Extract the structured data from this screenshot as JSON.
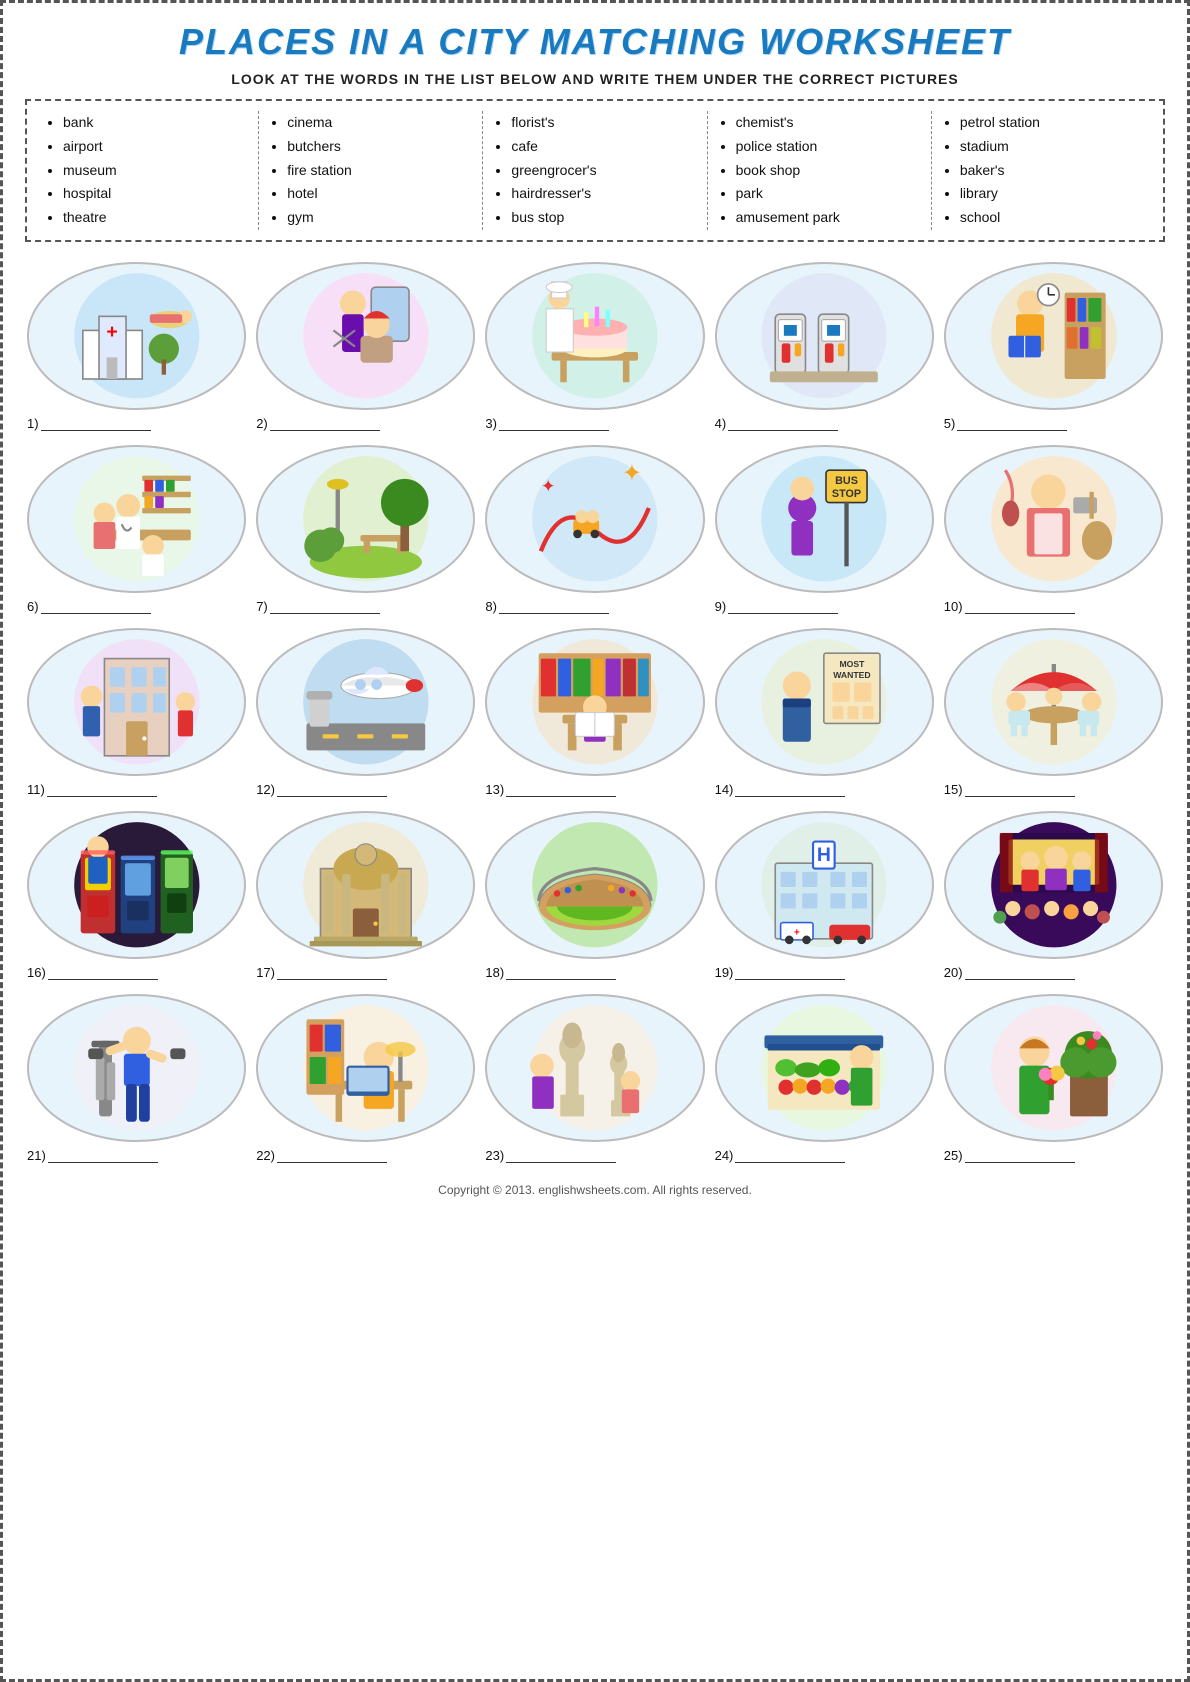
{
  "title": "Places in a City Matching Worksheet",
  "subtitle": "Look at the words in the list below and write them under the correct pictures",
  "word_columns": [
    {
      "items": [
        "bank",
        "airport",
        "museum",
        "hospital",
        "theatre"
      ]
    },
    {
      "items": [
        "cinema",
        "butchers",
        "fire station",
        "hotel",
        "gym"
      ]
    },
    {
      "items": [
        "florist's",
        "cafe",
        "greengrocer's",
        "hairdresser's",
        "bus stop"
      ]
    },
    {
      "items": [
        "chemist's",
        "police station",
        "book shop",
        "park",
        "amusement park"
      ]
    },
    {
      "items": [
        "petrol station",
        "stadium",
        "baker's",
        "library",
        "school"
      ]
    }
  ],
  "pictures": [
    {
      "number": "1",
      "label": "1)"
    },
    {
      "number": "2",
      "label": "2)"
    },
    {
      "number": "3",
      "label": "3)"
    },
    {
      "number": "4",
      "label": "4)"
    },
    {
      "number": "5",
      "label": "5)"
    },
    {
      "number": "6",
      "label": "6)"
    },
    {
      "number": "7",
      "label": "7)"
    },
    {
      "number": "8",
      "label": "8)"
    },
    {
      "number": "9",
      "label": "9)"
    },
    {
      "number": "10",
      "label": "10)"
    },
    {
      "number": "11",
      "label": "11)"
    },
    {
      "number": "12",
      "label": "12)"
    },
    {
      "number": "13",
      "label": "13)"
    },
    {
      "number": "14",
      "label": "14)"
    },
    {
      "number": "15",
      "label": "15)"
    },
    {
      "number": "16",
      "label": "16)"
    },
    {
      "number": "17",
      "label": "17)"
    },
    {
      "number": "18",
      "label": "18)"
    },
    {
      "number": "19",
      "label": "19)"
    },
    {
      "number": "20",
      "label": "20)"
    },
    {
      "number": "21",
      "label": "21)"
    },
    {
      "number": "22",
      "label": "22)"
    },
    {
      "number": "23",
      "label": "23)"
    },
    {
      "number": "24",
      "label": "24)"
    },
    {
      "number": "25",
      "label": "25)"
    }
  ],
  "copyright": "Copyright © 2013. englishwsheets.com. All rights reserved."
}
